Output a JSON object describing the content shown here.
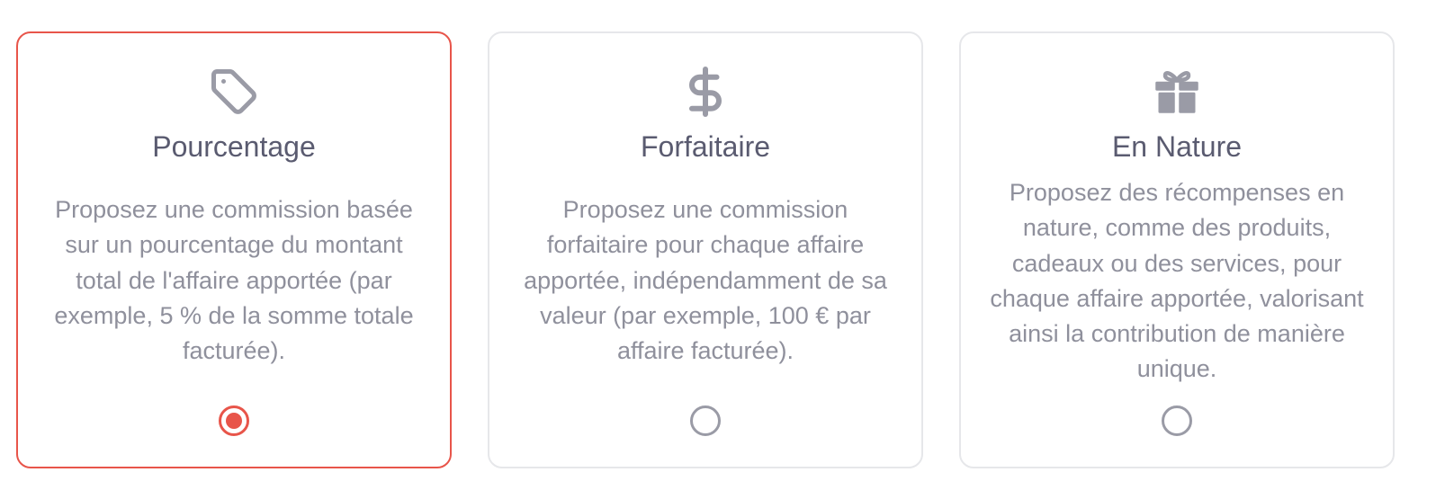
{
  "options": [
    {
      "title": "Pourcentage",
      "description": "Proposez une commission basée sur un pourcentage du montant total de l'affaire apportée (par exemple, 5 % de la somme totale facturée).",
      "icon": "tag-icon",
      "selected": true
    },
    {
      "title": "Forfaitaire",
      "description": "Proposez une commission forfaitaire pour chaque affaire apportée, indépendamment de sa valeur (par exemple, 100 € par affaire facturée).",
      "icon": "dollar-icon",
      "selected": false
    },
    {
      "title": "En Nature",
      "description": "Proposez des récompenses en nature, comme des produits, cadeaux ou des services, pour chaque affaire apportée, valorisant ainsi la contribution de manière unique.",
      "icon": "gift-icon",
      "selected": false
    }
  ],
  "colors": {
    "accent": "#e8554a",
    "border": "#e6e7ea",
    "title": "#5a5b70",
    "text": "#8f909c",
    "icon": "#9a9ba6"
  }
}
